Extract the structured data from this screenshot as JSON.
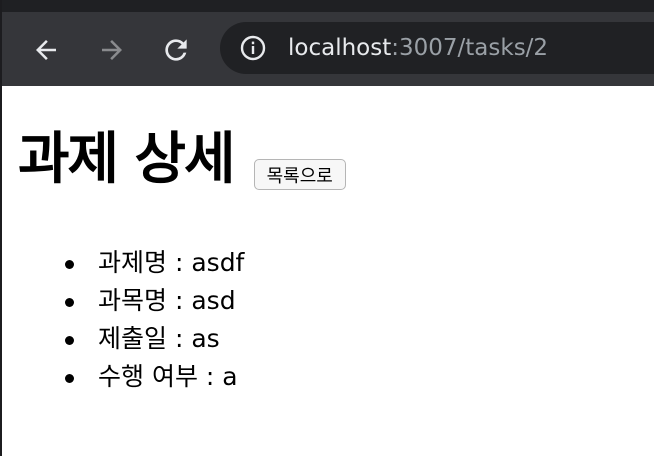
{
  "browser": {
    "url_host": "localhost",
    "url_path": ":3007/tasks/2",
    "icons": {
      "back": "arrow-left-icon",
      "forward": "arrow-right-icon",
      "reload": "reload-icon",
      "site_info": "info-icon"
    }
  },
  "page": {
    "title": "과제 상세",
    "back_button_label": "목록으로",
    "details": [
      {
        "label": "과제명",
        "separator": " : ",
        "value": "asdf"
      },
      {
        "label": "과목명",
        "separator": " : ",
        "value": "asd"
      },
      {
        "label": "제출일",
        "separator": " : ",
        "value": "as"
      },
      {
        "label": "수행 여부",
        "separator": " : ",
        "value": "a"
      }
    ]
  }
}
